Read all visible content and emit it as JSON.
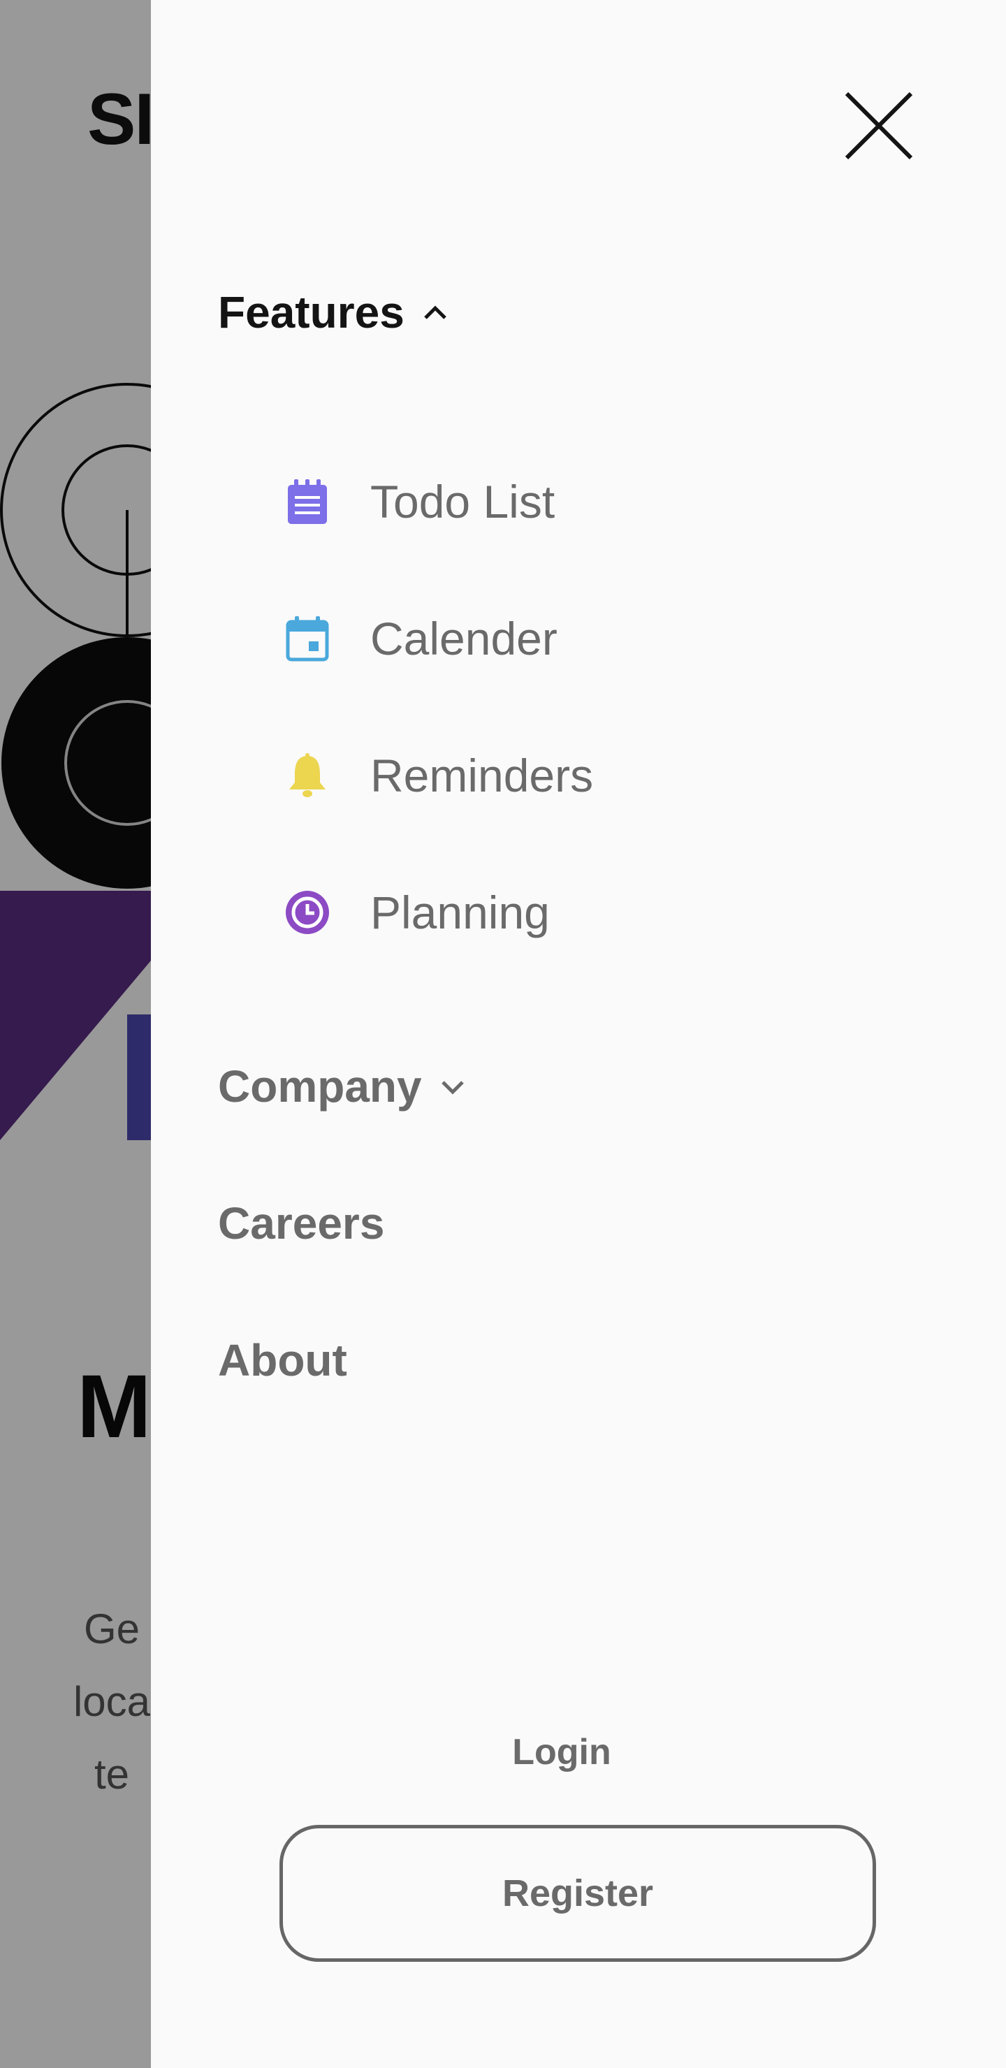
{
  "background_page": {
    "logo_partial": "SI",
    "heading_partial": "M",
    "body_partial": "Ge\nloca\nte"
  },
  "drawer": {
    "close_label": "Close",
    "nav": {
      "features": {
        "label": "Features",
        "expanded": true
      },
      "submenu": [
        {
          "label": "Todo List",
          "icon": "todo-list-icon",
          "color": "#7c6fe8"
        },
        {
          "label": "Calender",
          "icon": "calendar-icon",
          "color": "#4aa8dc"
        },
        {
          "label": "Reminders",
          "icon": "bell-icon",
          "color": "#ecd54f"
        },
        {
          "label": "Planning",
          "icon": "clock-icon",
          "color": "#8c4bc4"
        }
      ],
      "company": {
        "label": "Company",
        "expanded": false
      },
      "careers": {
        "label": "Careers"
      },
      "about": {
        "label": "About"
      }
    },
    "login_label": "Login",
    "register_label": "Register"
  },
  "colors": {
    "overlay": "rgba(0,0,0,0.40)",
    "drawer_bg": "#fafafa",
    "text_active": "#141414",
    "text_muted": "#6a6a6a",
    "hero_purple": "#5a2d82",
    "hero_blue": "#4b48b0"
  }
}
